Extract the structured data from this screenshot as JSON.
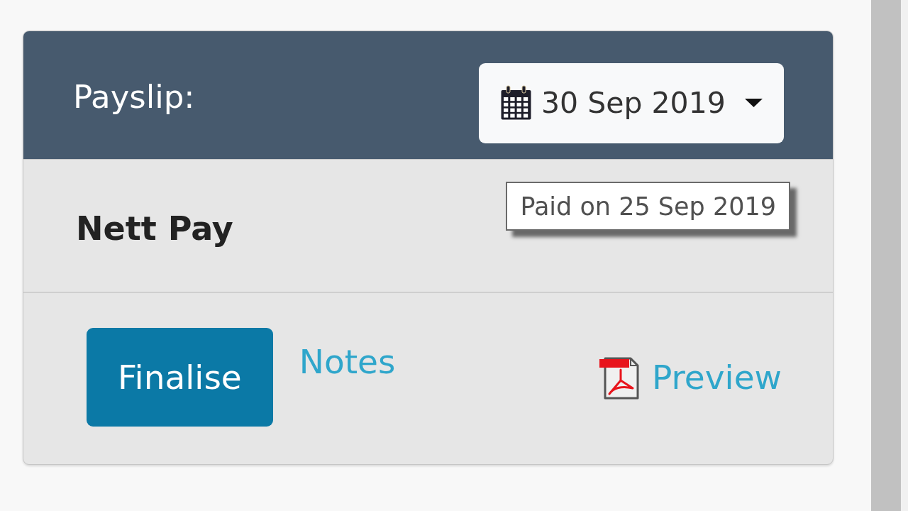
{
  "card": {
    "header": {
      "title": "Payslip:",
      "date_picker": {
        "value": "30 Sep 2019"
      }
    },
    "summary": {
      "label": "Nett Pay"
    },
    "tooltip": {
      "text": "Paid on 25 Sep 2019"
    },
    "actions": {
      "finalise_button": "Finalise",
      "notes_link": "Notes",
      "preview_link": "Preview"
    }
  }
}
